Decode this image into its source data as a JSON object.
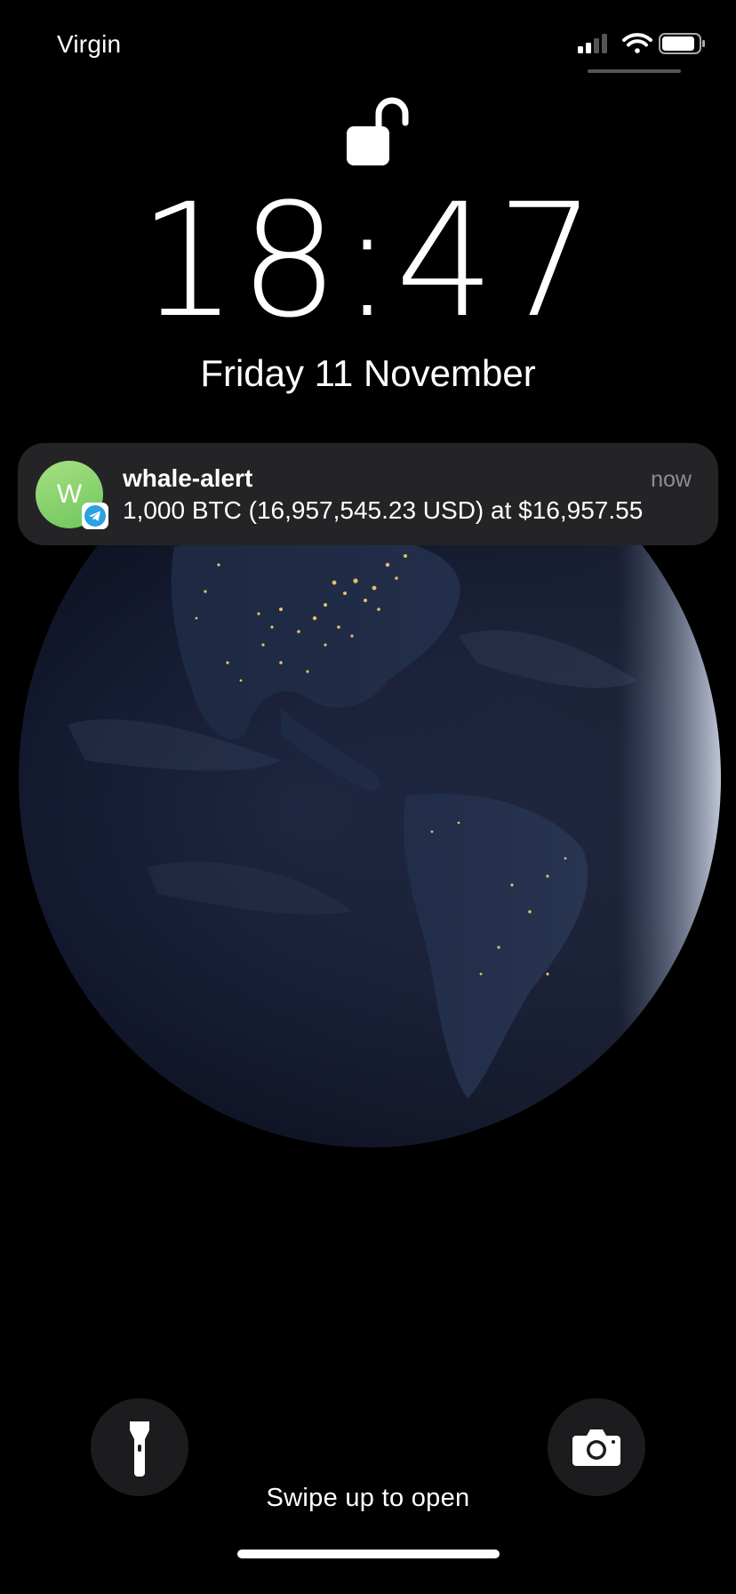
{
  "status_bar": {
    "carrier": "Virgin",
    "icons": [
      "cellular-signal-icon",
      "wifi-icon",
      "battery-icon"
    ]
  },
  "lock_screen": {
    "lock_icon": "unlocked-padlock-icon",
    "time": "18:47",
    "date": "Friday 11 November"
  },
  "notification": {
    "avatar_initial": "W",
    "app_badge_icon": "telegram-icon",
    "title": "whale-alert",
    "time": "now",
    "body": "1,000 BTC (16,957,545.23 USD) at $16,957.55"
  },
  "wallpaper": {
    "subject": "earth-at-night-icon"
  },
  "bottom": {
    "flashlight_icon": "flashlight-icon",
    "camera_icon": "camera-icon",
    "swipe_hint": "Swipe up to open"
  },
  "colors": {
    "background": "#000000",
    "notification_bg": "#242426",
    "avatar": "#8fd26f",
    "telegram": "#2aa1e0"
  }
}
